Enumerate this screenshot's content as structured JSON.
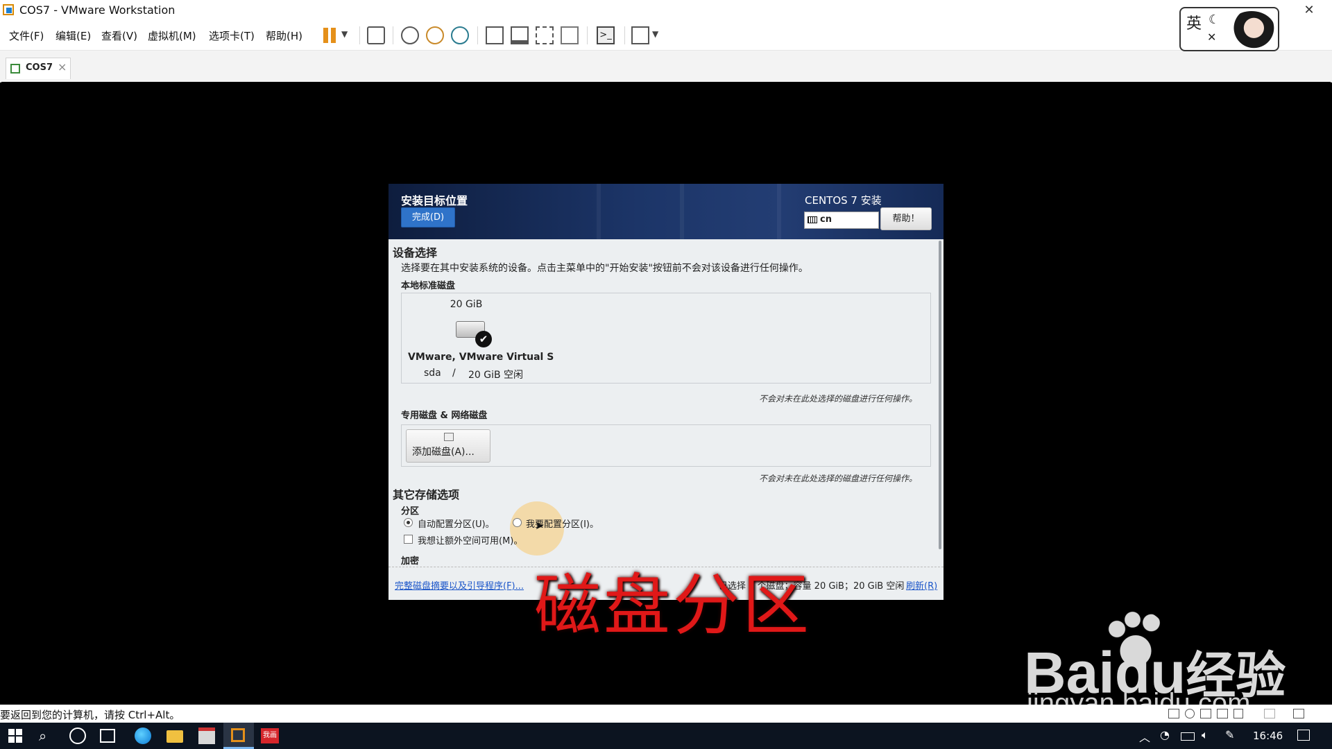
{
  "window": {
    "title": "COS7 - VMware Workstation",
    "close_glyph": "✕"
  },
  "menu": {
    "items": [
      "文件(F)",
      "编辑(E)",
      "查看(V)",
      "虚拟机(M)",
      "选项卡(T)",
      "帮助(H)"
    ]
  },
  "overlay_badge": {
    "text": "英"
  },
  "tab": {
    "label": "COS7",
    "close": "×"
  },
  "installer": {
    "header_title": "安装目标位置",
    "done_button": "完成(D)",
    "product": "CENTOS 7 安装",
    "keyboard_layout": "cn",
    "help_button": "帮助！",
    "device_selection_title": "设备选择",
    "device_selection_desc": "选择要在其中安装系统的设备。点击主菜单中的\"开始安装\"按钮前不会对该设备进行任何操作。",
    "local_disks_title": "本地标准磁盘",
    "disk": {
      "size": "20 GiB",
      "name": "VMware, VMware Virtual S",
      "dev": "sda",
      "sep": "/",
      "free": "20 GiB 空闲"
    },
    "hint_unselected": "不会对未在此处选择的磁盘进行任何操作。",
    "special_disks_title": "专用磁盘 & 网络磁盘",
    "add_disk_button": "添加磁盘(A)...",
    "other_storage_title": "其它存储选项",
    "partition_title": "分区",
    "auto_partition": "自动配置分区(U)。",
    "manual_partition": "我要配置分区(I)。",
    "extra_space": "我想让额外空间可用(M)。",
    "encryption_title": "加密",
    "summary_link": "完整磁盘摘要以及引导程序(F)...",
    "summary_status": "已选择 1 个磁盘；容量 20 GiB；20 GiB 空闲",
    "refresh_link": "刷新(R)"
  },
  "status_bar": {
    "text": "要返回到您的计算机，请按 Ctrl+Alt。"
  },
  "taskbar": {
    "time": "16:46",
    "app_badge": "我画"
  },
  "watermark": {
    "caption": "磁盘分区",
    "logo": "Bai",
    "logo_tail": "经验",
    "url": "jingyan.baidu.com"
  },
  "colors": {
    "accent_blue": "#2f73c9",
    "header_dark": "#0e1d3e",
    "caption_red": "#e01818"
  }
}
